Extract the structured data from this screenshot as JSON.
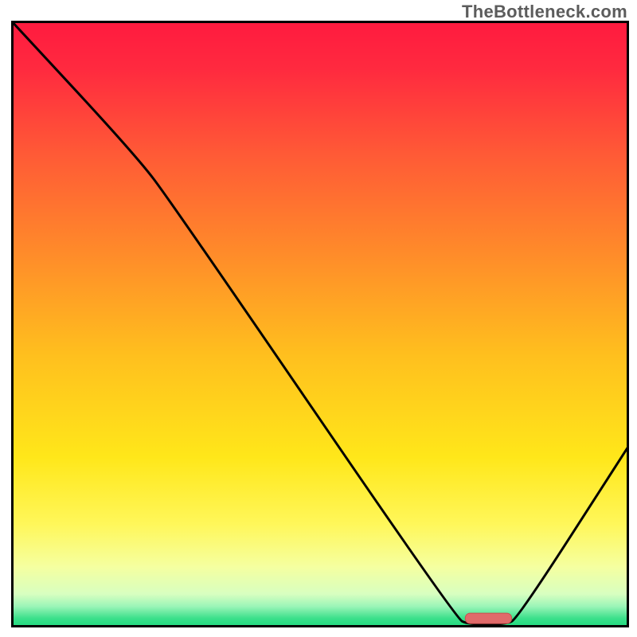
{
  "attribution": "TheBottleneck.com",
  "chart_data": {
    "type": "line",
    "title": "",
    "xlabel": "",
    "ylabel": "",
    "xlim": [
      0,
      100
    ],
    "ylim": [
      0,
      100
    ],
    "curve": [
      {
        "x": 0,
        "y": 100
      },
      {
        "x": 20,
        "y": 78
      },
      {
        "x": 26,
        "y": 70
      },
      {
        "x": 72,
        "y": 1.5
      },
      {
        "x": 74,
        "y": 0.5
      },
      {
        "x": 80,
        "y": 0.5
      },
      {
        "x": 82,
        "y": 1.5
      },
      {
        "x": 100,
        "y": 30
      }
    ],
    "marker": {
      "x_start": 73.5,
      "x_end": 81,
      "y": 1.5
    },
    "gradient_stops": [
      {
        "offset": 0.0,
        "color": "#ff1a3f"
      },
      {
        "offset": 0.08,
        "color": "#ff2a3f"
      },
      {
        "offset": 0.22,
        "color": "#ff5a36"
      },
      {
        "offset": 0.38,
        "color": "#ff8a2a"
      },
      {
        "offset": 0.55,
        "color": "#ffbf1e"
      },
      {
        "offset": 0.72,
        "color": "#ffe71a"
      },
      {
        "offset": 0.83,
        "color": "#fff75a"
      },
      {
        "offset": 0.9,
        "color": "#f5ffa0"
      },
      {
        "offset": 0.945,
        "color": "#d8ffc0"
      },
      {
        "offset": 0.965,
        "color": "#9cf5b8"
      },
      {
        "offset": 0.985,
        "color": "#3be08b"
      },
      {
        "offset": 1.0,
        "color": "#1fd97e"
      }
    ],
    "colors": {
      "curve": "#000000",
      "frame": "#000000",
      "marker_fill": "#e06a6a",
      "marker_stroke": "#c94f4f"
    }
  }
}
